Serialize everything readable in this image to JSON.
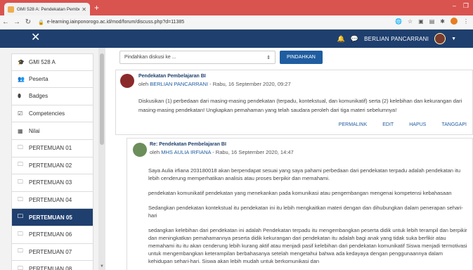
{
  "browser": {
    "tab_title": "GMI 528 A: Pendekatan Pembel...",
    "new_tab": "+",
    "url": "e-learning.iainponorogo.ac.id/mod/forum/discuss.php?d=11385"
  },
  "topbar": {
    "close": "✕",
    "user_name": "BERLIAN PANCARRANI"
  },
  "sidebar": {
    "items": [
      {
        "icon": "graduation-cap-icon",
        "glyph": "🎓",
        "label": "GMI 528 A"
      },
      {
        "icon": "users-icon",
        "glyph": "👥",
        "label": "Peserta"
      },
      {
        "icon": "badge-icon",
        "glyph": "⬮",
        "label": "Badges"
      },
      {
        "icon": "checkbox-icon",
        "glyph": "☑",
        "label": "Competencies"
      },
      {
        "icon": "grid-icon",
        "glyph": "▦",
        "label": "Nilai"
      },
      {
        "icon": "folder-icon",
        "glyph": "🗀",
        "label": "PERTEMUAN 01"
      },
      {
        "icon": "folder-icon",
        "glyph": "🗀",
        "label": "PERTEMUAN 02"
      },
      {
        "icon": "folder-icon",
        "glyph": "🗀",
        "label": "PERTEMUAN 03"
      },
      {
        "icon": "folder-icon",
        "glyph": "🗀",
        "label": "PERTEMUAN 04"
      },
      {
        "icon": "folder-icon",
        "glyph": "🗀",
        "label": "PERTEMUAN 05",
        "active": true
      },
      {
        "icon": "folder-icon",
        "glyph": "🗀",
        "label": "PERTEMUAN 06"
      },
      {
        "icon": "folder-icon",
        "glyph": "🗀",
        "label": "PERTEMUAN 07"
      },
      {
        "icon": "folder-icon",
        "glyph": "🗀",
        "label": "PERTEMUAN 08"
      }
    ]
  },
  "move": {
    "select_value": "Pindahkan diskusi ke ...",
    "button": "PINDAHKAN"
  },
  "post1": {
    "subject": "Pendekatan Pembelajaran BI",
    "by": "oleh ",
    "author": "BERLIAN PANCARRANI",
    "date": " - Rabu, 16 September 2020, 09:27",
    "body": "Diskusikan (1) perbedaan dari masing-masing pendekatan (terpadu, kontekstual, dan komunikatif) serta (2) kelebihan dan kekurangan dari masing-masing pendekatan! Ungkapkan pemahaman yang telah saudara peroleh  dari tiga materi sebelumnya!",
    "actions": [
      "PERMALINK",
      "EDIT",
      "HAPUS",
      "TANGGAPI"
    ]
  },
  "post2": {
    "subject": "Re: Pendekatan Pembelajaran BI",
    "by": "oleh ",
    "author": "MHS AULIA IRFIANA",
    "date": " - Rabu, 16 September 2020, 14:47",
    "paragraphs": [
      "Saya Aulia irfiana 203180018 akan berpendapat sesuai yang saya pahami  perbedaan dari pendekatan terpadu adalah pendekatan itu lebih cenderung memperhatikan analisis atau proses berpikir dan memahami.",
      "pendekatan komunikatif  pendekatan yang menekankan pada  komunikasi atau pengembangan mengenai kompetensi kebahasaan",
      "Sedangkan pendekatan kontekstual itu pendekatan ini itu lebih mengkaitkan materi dengan dan dihubungkan dalam penerapan sehari-hari",
      "sedangkan kelebihan dari pendekatan ini adalah Pendekatan terpadu itu mengembangkan peserta didik untuk lebih terampil dan berpikir dan meningkatkan pemahamannya peserta didik  kekurangan dari pendekatan itu adalah bagi anak yang tidak suka berfikir atau memahami itu itu akan cenderung lebih kurang aktif atau menjadi pasif kelebihan dari pendekatan komunikatif Siswa menjadi termotivasi untuk mengembangkan keterampilan berbahasanya setelah mengetahui bahwa ada kedayaya dengan penggunaannya dalam kehidupan sehari-hari. Siswa akan lebih mudah untuk berkomunikasi dan"
    ]
  }
}
